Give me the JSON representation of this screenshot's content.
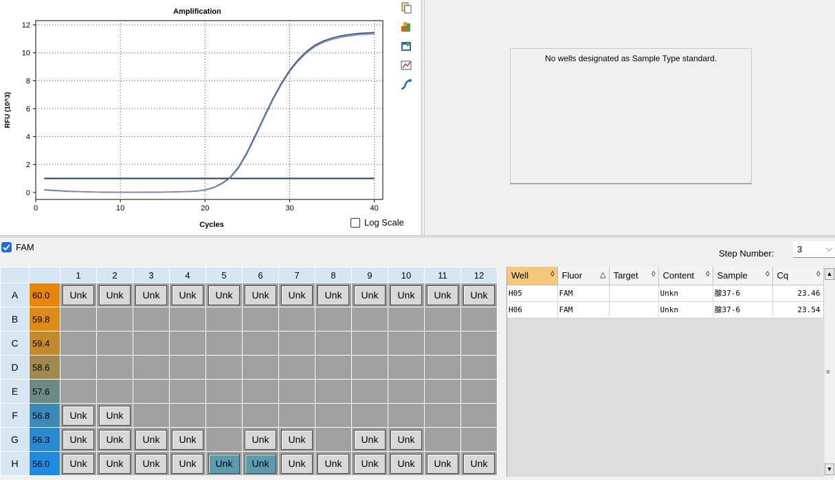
{
  "chart_data": {
    "type": "line",
    "title": "Amplification",
    "xlabel": "Cycles",
    "ylabel": "RFU (10^3)",
    "xlim": [
      0,
      41
    ],
    "ylim": [
      -0.5,
      12.3
    ],
    "xticks": [
      "0",
      "10",
      "20",
      "30",
      "40"
    ],
    "yticks": [
      "0",
      "2",
      "4",
      "6",
      "8",
      "10",
      "12"
    ],
    "grid": true,
    "threshold": 1.0,
    "series": [
      {
        "x": [
          1,
          2,
          4,
          6,
          8,
          10,
          12,
          14,
          16,
          18,
          19,
          20,
          21,
          22,
          23,
          24,
          25,
          26,
          27,
          28,
          29,
          30,
          31,
          32,
          33,
          34,
          35,
          36,
          37,
          38,
          39,
          40
        ],
        "y": [
          0.2,
          0.15,
          0.08,
          0.04,
          0.02,
          0.01,
          0.01,
          0.02,
          0.03,
          0.06,
          0.1,
          0.18,
          0.35,
          0.65,
          1.1,
          1.85,
          2.9,
          4.15,
          5.45,
          6.7,
          7.8,
          8.75,
          9.5,
          10.1,
          10.55,
          10.85,
          11.05,
          11.2,
          11.3,
          11.38,
          11.42,
          11.45
        ]
      },
      {
        "x": [
          1,
          2,
          4,
          6,
          8,
          10,
          12,
          14,
          16,
          18,
          19,
          20,
          21,
          22,
          23,
          24,
          25,
          26,
          27,
          28,
          29,
          30,
          31,
          32,
          33,
          34,
          35,
          36,
          37,
          38,
          39,
          40
        ],
        "y": [
          0.18,
          0.13,
          0.07,
          0.04,
          0.02,
          0.01,
          0.01,
          0.02,
          0.03,
          0.06,
          0.1,
          0.17,
          0.33,
          0.62,
          1.05,
          1.78,
          2.82,
          4.05,
          5.35,
          6.6,
          7.7,
          8.65,
          9.4,
          10.0,
          10.45,
          10.75,
          10.95,
          11.1,
          11.2,
          11.28,
          11.32,
          11.35
        ]
      }
    ]
  },
  "chart": {
    "log_scale_label": "Log Scale"
  },
  "toolbar_icons": [
    "copy-icon",
    "export-icon",
    "save-image-icon",
    "chart-settings-icon",
    "analysis-icon"
  ],
  "standard_curve": {
    "message": "No wells designated as Sample Type standard."
  },
  "fluor": {
    "name": "FAM",
    "checked": true
  },
  "step": {
    "label": "Step Number:",
    "value": "3"
  },
  "plate": {
    "columns": [
      "1",
      "2",
      "3",
      "4",
      "5",
      "6",
      "7",
      "8",
      "9",
      "10",
      "11",
      "12"
    ],
    "rows": [
      {
        "label": "A",
        "temp": "60.0",
        "color": "#e8860a",
        "wells": [
          "Unk",
          "Unk",
          "Unk",
          "Unk",
          "Unk",
          "Unk",
          "Unk",
          "Unk",
          "Unk",
          "Unk",
          "Unk",
          "Unk"
        ]
      },
      {
        "label": "B",
        "temp": "59.8",
        "color": "#de8a14",
        "wells": [
          "",
          "",
          "",
          "",
          "",
          "",
          "",
          "",
          "",
          "",
          "",
          ""
        ]
      },
      {
        "label": "C",
        "temp": "59.4",
        "color": "#c48a2c",
        "wells": [
          "",
          "",
          "",
          "",
          "",
          "",
          "",
          "",
          "",
          "",
          "",
          ""
        ]
      },
      {
        "label": "D",
        "temp": "58.6",
        "color": "#a08a50",
        "wells": [
          "",
          "",
          "",
          "",
          "",
          "",
          "",
          "",
          "",
          "",
          "",
          ""
        ]
      },
      {
        "label": "E",
        "temp": "57.6",
        "color": "#6a8a82",
        "wells": [
          "",
          "",
          "",
          "",
          "",
          "",
          "",
          "",
          "",
          "",
          "",
          ""
        ]
      },
      {
        "label": "F",
        "temp": "56.8",
        "color": "#3a8ab8",
        "wells": [
          "Unk",
          "Unk",
          "",
          "",
          "",
          "",
          "",
          "",
          "",
          "",
          "",
          ""
        ]
      },
      {
        "label": "G",
        "temp": "56.3",
        "color": "#2a8ad0",
        "wells": [
          "Unk",
          "Unk",
          "Unk",
          "Unk",
          "",
          "Unk",
          "Unk",
          "",
          "Unk",
          "Unk",
          "",
          ""
        ]
      },
      {
        "label": "H",
        "temp": "56.0",
        "color": "#1e8ae0",
        "wells": [
          "Unk",
          "Unk",
          "Unk",
          "Unk",
          "Unk",
          "Unk",
          "Unk",
          "Unk",
          "Unk",
          "Unk",
          "Unk",
          "Unk"
        ],
        "selected": [
          4,
          5
        ]
      }
    ]
  },
  "well_table": {
    "headers": [
      {
        "label": "Well",
        "sort": "◊"
      },
      {
        "label": "Fluor",
        "sort": "△"
      },
      {
        "label": "Target",
        "sort": "◊"
      },
      {
        "label": "Content",
        "sort": "◊"
      },
      {
        "label": "Sample",
        "sort": "◊"
      },
      {
        "label": "Cq",
        "sort": "◊"
      }
    ],
    "rows": [
      {
        "well": "H05",
        "fluor": "FAM",
        "target": "",
        "content": "Unkn",
        "sample": "腺37-6",
        "cq": "23.46"
      },
      {
        "well": "H06",
        "fluor": "FAM",
        "target": "",
        "content": "Unkn",
        "sample": "腺37-6",
        "cq": "23.54"
      }
    ]
  }
}
